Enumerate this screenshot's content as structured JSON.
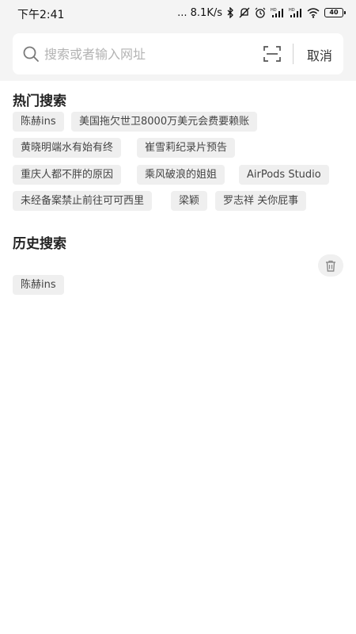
{
  "status_bar": {
    "time": "下午2:41",
    "speed": "... 8.1K/s",
    "battery": "40",
    "icons": [
      "bluetooth-icon",
      "mute-icon",
      "alarm-icon",
      "signal-hd-icon",
      "signal-hd-icon",
      "wifi-icon",
      "battery-icon"
    ]
  },
  "search": {
    "placeholder": "搜索或者输入网址",
    "value": "",
    "cancel_label": "取消",
    "icons": [
      "search-icon",
      "scan-icon"
    ]
  },
  "hot_search": {
    "title": "热门搜索",
    "items": [
      "陈赫ins",
      "美国拖欠世卫8000万美元会费要赖账",
      "黄晓明端水有始有终",
      "崔雪莉纪录片预告",
      "重庆人都不胖的原因",
      "乘风破浪的姐姐",
      "AirPods Studio",
      "未经备案禁止前往可可西里",
      "梁颖",
      "罗志祥 关你屁事"
    ]
  },
  "history": {
    "title": "历史搜索",
    "clear_icon": "trash-icon",
    "items": [
      "陈赫ins"
    ]
  },
  "colors": {
    "background": "#ffffff",
    "header_background": "#f4f4f4",
    "tag_background": "#efefef",
    "placeholder": "#b3b3b3"
  }
}
